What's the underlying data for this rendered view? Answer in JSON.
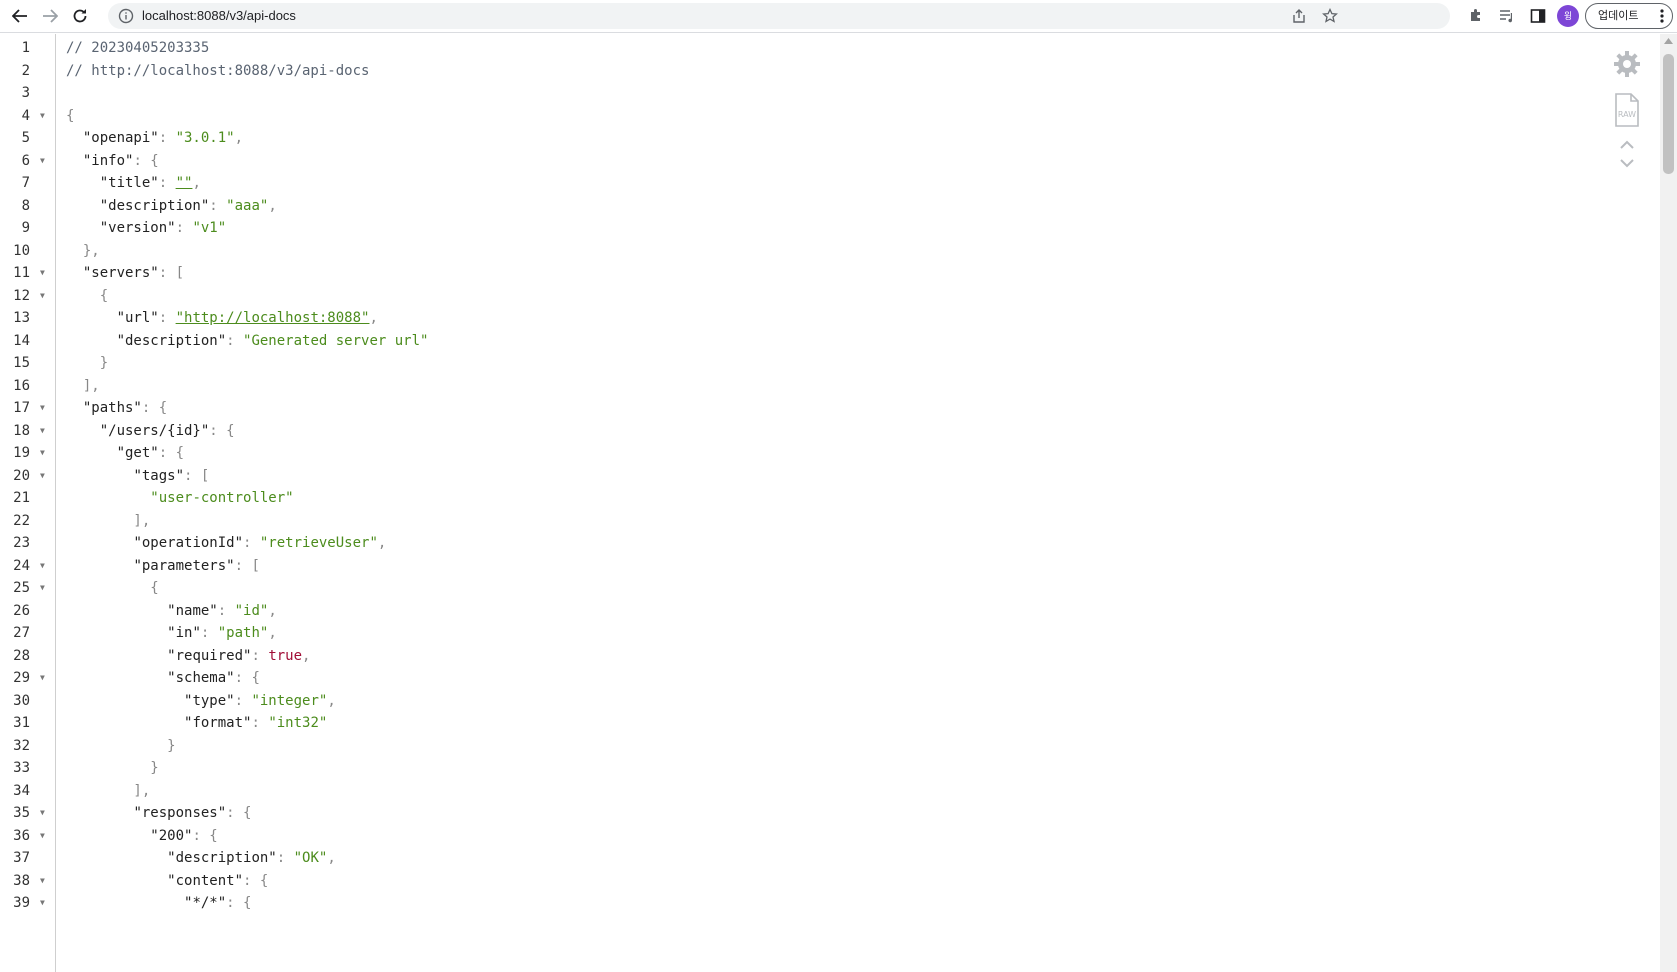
{
  "browser": {
    "url": "localhost:8088/v3/api-docs",
    "avatar_letter": "윙",
    "update_label": "업데이트"
  },
  "viewer": {
    "lines": [
      {
        "n": "1",
        "fold": false,
        "tokens": [
          {
            "t": "// 20230405203335",
            "c": "comment"
          }
        ]
      },
      {
        "n": "2",
        "fold": false,
        "tokens": [
          {
            "t": "// http://localhost:8088/v3/api-docs",
            "c": "comment"
          }
        ]
      },
      {
        "n": "3",
        "fold": false,
        "tokens": []
      },
      {
        "n": "4",
        "fold": true,
        "tokens": [
          {
            "t": "{",
            "c": "punct"
          }
        ]
      },
      {
        "n": "5",
        "fold": false,
        "tokens": [
          {
            "t": "  ",
            "c": "punct"
          },
          {
            "t": "\"openapi\"",
            "c": "key"
          },
          {
            "t": ": ",
            "c": "punct"
          },
          {
            "t": "\"3.0.1\"",
            "c": "str"
          },
          {
            "t": ",",
            "c": "punct"
          }
        ]
      },
      {
        "n": "6",
        "fold": true,
        "tokens": [
          {
            "t": "  ",
            "c": "punct"
          },
          {
            "t": "\"info\"",
            "c": "key"
          },
          {
            "t": ": {",
            "c": "punct"
          }
        ]
      },
      {
        "n": "7",
        "fold": false,
        "tokens": [
          {
            "t": "    ",
            "c": "punct"
          },
          {
            "t": "\"title\"",
            "c": "key"
          },
          {
            "t": ": ",
            "c": "punct"
          },
          {
            "t": "\"\"",
            "c": "link"
          },
          {
            "t": ",",
            "c": "punct"
          }
        ]
      },
      {
        "n": "8",
        "fold": false,
        "tokens": [
          {
            "t": "    ",
            "c": "punct"
          },
          {
            "t": "\"description\"",
            "c": "key"
          },
          {
            "t": ": ",
            "c": "punct"
          },
          {
            "t": "\"aaa\"",
            "c": "str"
          },
          {
            "t": ",",
            "c": "punct"
          }
        ]
      },
      {
        "n": "9",
        "fold": false,
        "tokens": [
          {
            "t": "    ",
            "c": "punct"
          },
          {
            "t": "\"version\"",
            "c": "key"
          },
          {
            "t": ": ",
            "c": "punct"
          },
          {
            "t": "\"v1\"",
            "c": "str"
          }
        ]
      },
      {
        "n": "10",
        "fold": false,
        "tokens": [
          {
            "t": "  },",
            "c": "punct"
          }
        ]
      },
      {
        "n": "11",
        "fold": true,
        "tokens": [
          {
            "t": "  ",
            "c": "punct"
          },
          {
            "t": "\"servers\"",
            "c": "key"
          },
          {
            "t": ": [",
            "c": "punct"
          }
        ]
      },
      {
        "n": "12",
        "fold": true,
        "tokens": [
          {
            "t": "    {",
            "c": "punct"
          }
        ]
      },
      {
        "n": "13",
        "fold": false,
        "tokens": [
          {
            "t": "      ",
            "c": "punct"
          },
          {
            "t": "\"url\"",
            "c": "key"
          },
          {
            "t": ": ",
            "c": "punct"
          },
          {
            "t": "\"http://localhost:8088\"",
            "c": "link"
          },
          {
            "t": ",",
            "c": "punct"
          }
        ]
      },
      {
        "n": "14",
        "fold": false,
        "tokens": [
          {
            "t": "      ",
            "c": "punct"
          },
          {
            "t": "\"description\"",
            "c": "key"
          },
          {
            "t": ": ",
            "c": "punct"
          },
          {
            "t": "\"Generated server url\"",
            "c": "str"
          }
        ]
      },
      {
        "n": "15",
        "fold": false,
        "tokens": [
          {
            "t": "    }",
            "c": "punct"
          }
        ]
      },
      {
        "n": "16",
        "fold": false,
        "tokens": [
          {
            "t": "  ],",
            "c": "punct"
          }
        ]
      },
      {
        "n": "17",
        "fold": true,
        "tokens": [
          {
            "t": "  ",
            "c": "punct"
          },
          {
            "t": "\"paths\"",
            "c": "key"
          },
          {
            "t": ": {",
            "c": "punct"
          }
        ]
      },
      {
        "n": "18",
        "fold": true,
        "tokens": [
          {
            "t": "    ",
            "c": "punct"
          },
          {
            "t": "\"/users/{id}\"",
            "c": "key"
          },
          {
            "t": ": {",
            "c": "punct"
          }
        ]
      },
      {
        "n": "19",
        "fold": true,
        "tokens": [
          {
            "t": "      ",
            "c": "punct"
          },
          {
            "t": "\"get\"",
            "c": "key"
          },
          {
            "t": ": {",
            "c": "punct"
          }
        ]
      },
      {
        "n": "20",
        "fold": true,
        "tokens": [
          {
            "t": "        ",
            "c": "punct"
          },
          {
            "t": "\"tags\"",
            "c": "key"
          },
          {
            "t": ": [",
            "c": "punct"
          }
        ]
      },
      {
        "n": "21",
        "fold": false,
        "tokens": [
          {
            "t": "          ",
            "c": "punct"
          },
          {
            "t": "\"user-controller\"",
            "c": "str"
          }
        ]
      },
      {
        "n": "22",
        "fold": false,
        "tokens": [
          {
            "t": "        ],",
            "c": "punct"
          }
        ]
      },
      {
        "n": "23",
        "fold": false,
        "tokens": [
          {
            "t": "        ",
            "c": "punct"
          },
          {
            "t": "\"operationId\"",
            "c": "key"
          },
          {
            "t": ": ",
            "c": "punct"
          },
          {
            "t": "\"retrieveUser\"",
            "c": "str"
          },
          {
            "t": ",",
            "c": "punct"
          }
        ]
      },
      {
        "n": "24",
        "fold": true,
        "tokens": [
          {
            "t": "        ",
            "c": "punct"
          },
          {
            "t": "\"parameters\"",
            "c": "key"
          },
          {
            "t": ": [",
            "c": "punct"
          }
        ]
      },
      {
        "n": "25",
        "fold": true,
        "tokens": [
          {
            "t": "          {",
            "c": "punct"
          }
        ]
      },
      {
        "n": "26",
        "fold": false,
        "tokens": [
          {
            "t": "            ",
            "c": "punct"
          },
          {
            "t": "\"name\"",
            "c": "key"
          },
          {
            "t": ": ",
            "c": "punct"
          },
          {
            "t": "\"id\"",
            "c": "str"
          },
          {
            "t": ",",
            "c": "punct"
          }
        ]
      },
      {
        "n": "27",
        "fold": false,
        "tokens": [
          {
            "t": "            ",
            "c": "punct"
          },
          {
            "t": "\"in\"",
            "c": "key"
          },
          {
            "t": ": ",
            "c": "punct"
          },
          {
            "t": "\"path\"",
            "c": "str"
          },
          {
            "t": ",",
            "c": "punct"
          }
        ]
      },
      {
        "n": "28",
        "fold": false,
        "tokens": [
          {
            "t": "            ",
            "c": "punct"
          },
          {
            "t": "\"required\"",
            "c": "key"
          },
          {
            "t": ": ",
            "c": "punct"
          },
          {
            "t": "true",
            "c": "bool"
          },
          {
            "t": ",",
            "c": "punct"
          }
        ]
      },
      {
        "n": "29",
        "fold": true,
        "tokens": [
          {
            "t": "            ",
            "c": "punct"
          },
          {
            "t": "\"schema\"",
            "c": "key"
          },
          {
            "t": ": {",
            "c": "punct"
          }
        ]
      },
      {
        "n": "30",
        "fold": false,
        "tokens": [
          {
            "t": "              ",
            "c": "punct"
          },
          {
            "t": "\"type\"",
            "c": "key"
          },
          {
            "t": ": ",
            "c": "punct"
          },
          {
            "t": "\"integer\"",
            "c": "str"
          },
          {
            "t": ",",
            "c": "punct"
          }
        ]
      },
      {
        "n": "31",
        "fold": false,
        "tokens": [
          {
            "t": "              ",
            "c": "punct"
          },
          {
            "t": "\"format\"",
            "c": "key"
          },
          {
            "t": ": ",
            "c": "punct"
          },
          {
            "t": "\"int32\"",
            "c": "str"
          }
        ]
      },
      {
        "n": "32",
        "fold": false,
        "tokens": [
          {
            "t": "            }",
            "c": "punct"
          }
        ]
      },
      {
        "n": "33",
        "fold": false,
        "tokens": [
          {
            "t": "          }",
            "c": "punct"
          }
        ]
      },
      {
        "n": "34",
        "fold": false,
        "tokens": [
          {
            "t": "        ],",
            "c": "punct"
          }
        ]
      },
      {
        "n": "35",
        "fold": true,
        "tokens": [
          {
            "t": "        ",
            "c": "punct"
          },
          {
            "t": "\"responses\"",
            "c": "key"
          },
          {
            "t": ": {",
            "c": "punct"
          }
        ]
      },
      {
        "n": "36",
        "fold": true,
        "tokens": [
          {
            "t": "          ",
            "c": "punct"
          },
          {
            "t": "\"200\"",
            "c": "key"
          },
          {
            "t": ": {",
            "c": "punct"
          }
        ]
      },
      {
        "n": "37",
        "fold": false,
        "tokens": [
          {
            "t": "            ",
            "c": "punct"
          },
          {
            "t": "\"description\"",
            "c": "key"
          },
          {
            "t": ": ",
            "c": "punct"
          },
          {
            "t": "\"OK\"",
            "c": "str"
          },
          {
            "t": ",",
            "c": "punct"
          }
        ]
      },
      {
        "n": "38",
        "fold": true,
        "tokens": [
          {
            "t": "            ",
            "c": "punct"
          },
          {
            "t": "\"content\"",
            "c": "key"
          },
          {
            "t": ": {",
            "c": "punct"
          }
        ]
      },
      {
        "n": "39",
        "fold": true,
        "tokens": [
          {
            "t": "              ",
            "c": "punct"
          },
          {
            "t": "\"*/*\"",
            "c": "key"
          },
          {
            "t": ": {",
            "c": "punct"
          }
        ]
      }
    ],
    "raw_label": "RAW"
  }
}
